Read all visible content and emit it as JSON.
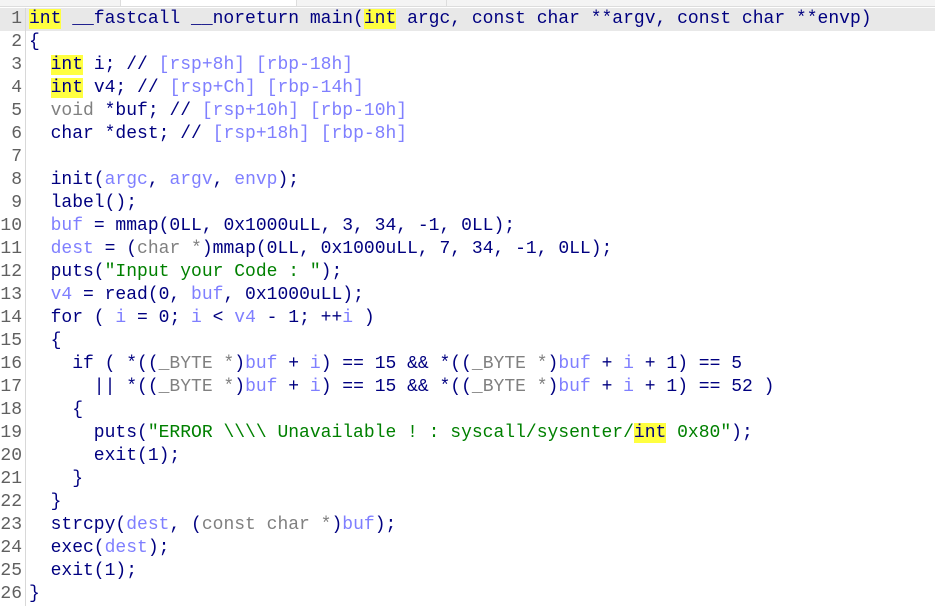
{
  "colors": {
    "default": "#000080",
    "type": "#808080",
    "variable": "#7f7fff",
    "string": "#008000",
    "highlight": "#ffff40",
    "current_line": "#e8e8e8"
  },
  "current_line": 1,
  "lines": [
    {
      "n": "1",
      "tokens": [
        [
          "int",
          "h"
        ],
        [
          " __fastcall __noreturn main(",
          "k"
        ],
        [
          "int",
          "h"
        ],
        [
          " argc, const char **argv, const char **envp)",
          "k"
        ]
      ]
    },
    {
      "n": "2",
      "tokens": [
        [
          "{",
          "k"
        ]
      ]
    },
    {
      "n": "3",
      "tokens": [
        [
          "  ",
          "k"
        ],
        [
          "int",
          "h"
        ],
        [
          " i; // ",
          "k"
        ],
        [
          "[rsp+8h] [rbp-18h]",
          "v"
        ]
      ]
    },
    {
      "n": "4",
      "tokens": [
        [
          "  ",
          "k"
        ],
        [
          "int",
          "h"
        ],
        [
          " v4; // ",
          "k"
        ],
        [
          "[rsp+Ch] [rbp-14h]",
          "v"
        ]
      ]
    },
    {
      "n": "5",
      "tokens": [
        [
          "  ",
          "k"
        ],
        [
          "void",
          "t"
        ],
        [
          " *buf; // ",
          "k"
        ],
        [
          "[rsp+10h] [rbp-10h]",
          "v"
        ]
      ]
    },
    {
      "n": "6",
      "tokens": [
        [
          "  char *dest; // ",
          "k"
        ],
        [
          "[rsp+18h] [rbp-8h]",
          "v"
        ]
      ]
    },
    {
      "n": "7",
      "tokens": []
    },
    {
      "n": "8",
      "tokens": [
        [
          "  init(",
          "k"
        ],
        [
          "argc",
          "v"
        ],
        [
          ", ",
          "k"
        ],
        [
          "argv",
          "v"
        ],
        [
          ", ",
          "k"
        ],
        [
          "envp",
          "v"
        ],
        [
          ");",
          "k"
        ]
      ]
    },
    {
      "n": "9",
      "tokens": [
        [
          "  label();",
          "k"
        ]
      ]
    },
    {
      "n": "10",
      "tokens": [
        [
          "  ",
          "k"
        ],
        [
          "buf",
          "v"
        ],
        [
          " = mmap(0LL, 0x1000uLL, 3, 34, -1, 0LL);",
          "k"
        ]
      ]
    },
    {
      "n": "11",
      "tokens": [
        [
          "  ",
          "k"
        ],
        [
          "dest",
          "v"
        ],
        [
          " = (",
          "k"
        ],
        [
          "char *",
          "t"
        ],
        [
          ")mmap(0LL, 0x1000uLL, 7, 34, -1, 0LL);",
          "k"
        ]
      ]
    },
    {
      "n": "12",
      "tokens": [
        [
          "  puts(",
          "k"
        ],
        [
          "\"Input your Code : \"",
          "s"
        ],
        [
          ");",
          "k"
        ]
      ]
    },
    {
      "n": "13",
      "tokens": [
        [
          "  ",
          "k"
        ],
        [
          "v4",
          "v"
        ],
        [
          " = read(0, ",
          "k"
        ],
        [
          "buf",
          "v"
        ],
        [
          ", 0x1000uLL);",
          "k"
        ]
      ]
    },
    {
      "n": "14",
      "tokens": [
        [
          "  for ( ",
          "k"
        ],
        [
          "i",
          "v"
        ],
        [
          " = 0; ",
          "k"
        ],
        [
          "i",
          "v"
        ],
        [
          " < ",
          "k"
        ],
        [
          "v4",
          "v"
        ],
        [
          " - 1; ++",
          "k"
        ],
        [
          "i",
          "v"
        ],
        [
          " )",
          "k"
        ]
      ]
    },
    {
      "n": "15",
      "tokens": [
        [
          "  {",
          "k"
        ]
      ]
    },
    {
      "n": "16",
      "tokens": [
        [
          "    if ( *((",
          "k"
        ],
        [
          "_BYTE *",
          "t"
        ],
        [
          ")",
          "k"
        ],
        [
          "buf",
          "v"
        ],
        [
          " + ",
          "k"
        ],
        [
          "i",
          "v"
        ],
        [
          ") == 15 && *((",
          "k"
        ],
        [
          "_BYTE *",
          "t"
        ],
        [
          ")",
          "k"
        ],
        [
          "buf",
          "v"
        ],
        [
          " + ",
          "k"
        ],
        [
          "i",
          "v"
        ],
        [
          " + 1) == 5",
          "k"
        ]
      ]
    },
    {
      "n": "17",
      "tokens": [
        [
          "      || *((",
          "k"
        ],
        [
          "_BYTE *",
          "t"
        ],
        [
          ")",
          "k"
        ],
        [
          "buf",
          "v"
        ],
        [
          " + ",
          "k"
        ],
        [
          "i",
          "v"
        ],
        [
          ") == 15 && *((",
          "k"
        ],
        [
          "_BYTE *",
          "t"
        ],
        [
          ")",
          "k"
        ],
        [
          "buf",
          "v"
        ],
        [
          " + ",
          "k"
        ],
        [
          "i",
          "v"
        ],
        [
          " + 1) == 52 )",
          "k"
        ]
      ]
    },
    {
      "n": "18",
      "tokens": [
        [
          "    {",
          "k"
        ]
      ]
    },
    {
      "n": "19",
      "tokens": [
        [
          "      puts(",
          "k"
        ],
        [
          "\"ERROR \\\\\\\\ Unavailable ! : syscall/sysenter/",
          "s"
        ],
        [
          "int",
          "h"
        ],
        [
          " 0x80\"",
          "s"
        ],
        [
          ");",
          "k"
        ]
      ]
    },
    {
      "n": "20",
      "tokens": [
        [
          "      exit(1);",
          "k"
        ]
      ]
    },
    {
      "n": "21",
      "tokens": [
        [
          "    }",
          "k"
        ]
      ]
    },
    {
      "n": "22",
      "tokens": [
        [
          "  }",
          "k"
        ]
      ]
    },
    {
      "n": "23",
      "tokens": [
        [
          "  strcpy(",
          "k"
        ],
        [
          "dest",
          "v"
        ],
        [
          ", (",
          "k"
        ],
        [
          "const char *",
          "t"
        ],
        [
          ")",
          "k"
        ],
        [
          "buf",
          "v"
        ],
        [
          ");",
          "k"
        ]
      ]
    },
    {
      "n": "24",
      "tokens": [
        [
          "  exec(",
          "k"
        ],
        [
          "dest",
          "v"
        ],
        [
          ");",
          "k"
        ]
      ]
    },
    {
      "n": "25",
      "tokens": [
        [
          "  exit(1);",
          "k"
        ]
      ]
    },
    {
      "n": "26",
      "tokens": [
        [
          "}",
          "k"
        ]
      ]
    }
  ]
}
